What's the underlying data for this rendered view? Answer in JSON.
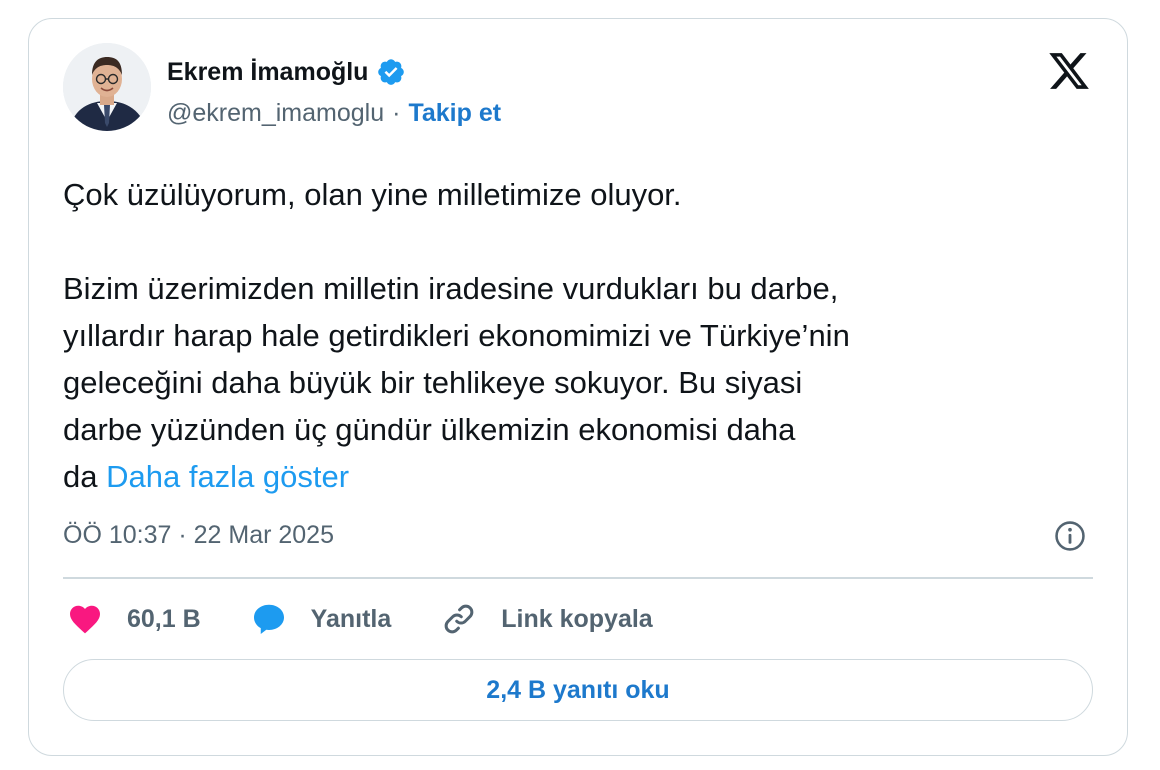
{
  "author": {
    "name": "Ekrem İmamoğlu",
    "handle": "@ekrem_imamoglu",
    "separator": "·",
    "follow_label": "Takip et",
    "verified_icon": "verified-badge-icon"
  },
  "tweet": {
    "paragraph1": "Çok üzülüyorum, olan yine milletimize oluyor.",
    "paragraph2_lines": [
      "Bizim üzerimizden milletin iradesine vurdukları bu darbe,",
      "yıllardır harap hale getirdikleri ekonomimizi ve Türkiye’nin",
      "geleceğini daha büyük bir tehlikeye sokuyor. Bu siyasi",
      "darbe yüzünden üç gündür ülkemizin ekonomisi daha"
    ],
    "last_word": "da",
    "show_more": "Daha fazla göster"
  },
  "meta": {
    "timestamp": "ÖÖ 10:37 · 22 Mar 2025"
  },
  "actions": {
    "likes": "60,1 B",
    "reply": "Yanıtla",
    "copy_link": "Link kopyala"
  },
  "read_replies": "2,4 B yanıtı oku",
  "colors": {
    "accent": "#1d9bf0",
    "link_bold": "#1d79cc",
    "heart": "#f91880",
    "muted": "#536471",
    "border": "#cfd9de"
  }
}
